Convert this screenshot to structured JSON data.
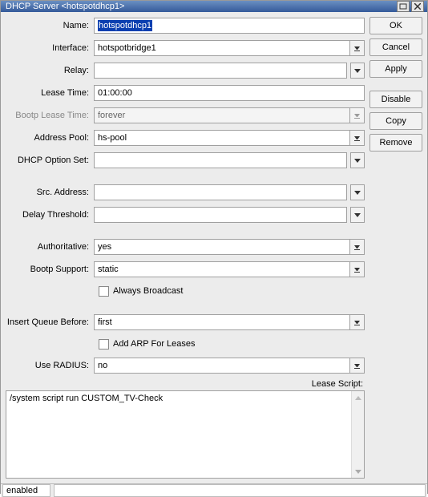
{
  "window": {
    "title": "DHCP Server <hotspotdhcp1>"
  },
  "buttons": {
    "ok": "OK",
    "cancel": "Cancel",
    "apply": "Apply",
    "disable": "Disable",
    "copy": "Copy",
    "remove": "Remove"
  },
  "labels": {
    "name": "Name:",
    "interface": "Interface:",
    "relay": "Relay:",
    "lease_time": "Lease Time:",
    "bootp_lease_time": "Bootp Lease Time:",
    "address_pool": "Address Pool:",
    "dhcp_option_set": "DHCP Option Set:",
    "src_address": "Src. Address:",
    "delay_threshold": "Delay Threshold:",
    "authoritative": "Authoritative:",
    "bootp_support": "Bootp Support:",
    "always_broadcast": "Always Broadcast",
    "insert_queue_before": "Insert Queue Before:",
    "add_arp": "Add ARP For Leases",
    "use_radius": "Use RADIUS:",
    "lease_script": "Lease Script:"
  },
  "values": {
    "name": "hotspotdhcp1",
    "interface": "hotspotbridge1",
    "relay": "",
    "lease_time": "01:00:00",
    "bootp_lease_time": "forever",
    "address_pool": "hs-pool",
    "dhcp_option_set": "",
    "src_address": "",
    "delay_threshold": "",
    "authoritative": "yes",
    "bootp_support": "static",
    "always_broadcast": false,
    "insert_queue_before": "first",
    "add_arp": false,
    "use_radius": "no",
    "lease_script": "/system script run CUSTOM_TV-Check"
  },
  "status": {
    "state": "enabled"
  }
}
